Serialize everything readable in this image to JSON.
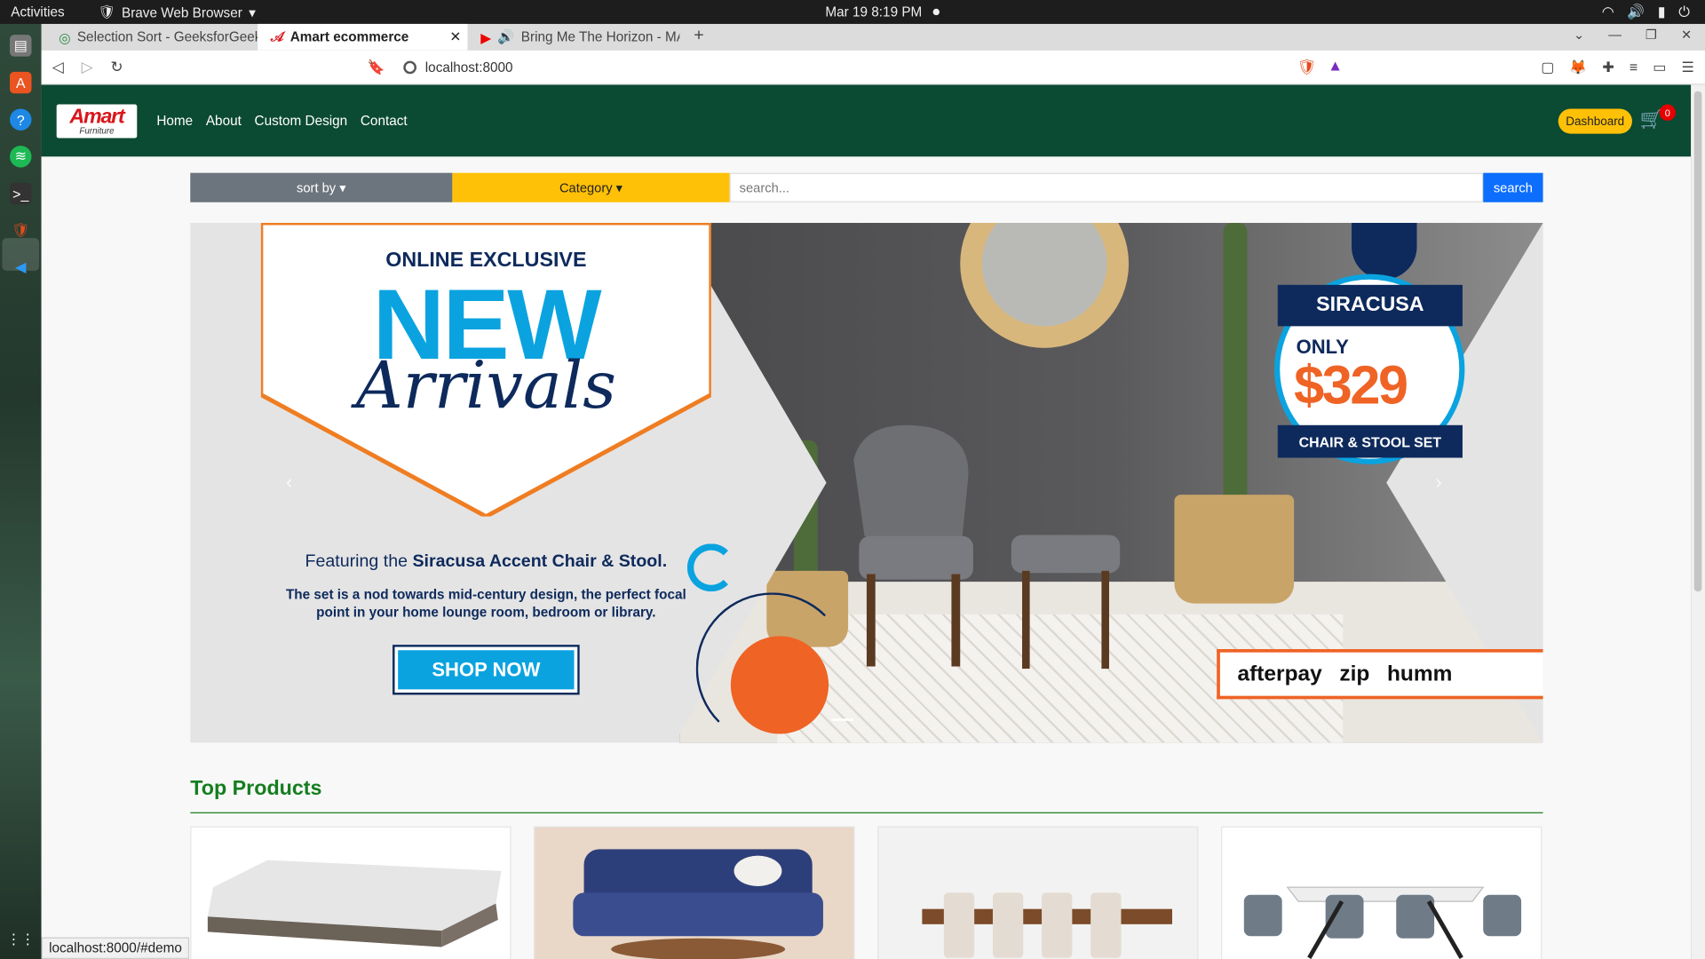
{
  "system": {
    "activities": "Activities",
    "app_name": "Brave Web Browser",
    "clock": "Mar 19  8:19 PM"
  },
  "tabs": [
    {
      "title": "Selection Sort - GeeksforGeek"
    },
    {
      "title": "Amart ecommerce"
    },
    {
      "title": "Bring Me The Horizon - MA"
    }
  ],
  "address": {
    "url": "localhost:8000"
  },
  "site": {
    "logo_main": "Amart",
    "logo_sub": "Furniture",
    "menu": [
      "Home",
      "About",
      "Custom Design",
      "Contact"
    ],
    "dashboard": "Dashboard",
    "cart_count": "0",
    "sort_by": "sort by",
    "category": "Category",
    "search_placeholder": "search...",
    "search_button": "search"
  },
  "banner": {
    "online": "ONLINE EXCLUSIVE",
    "new": "NEW",
    "arrivals": "Arrivals",
    "featuring": "Featuring the",
    "featuring_bold": "Siracusa Accent Chair & Stool.",
    "description": "The set is a nod towards mid-century design, the perfect focal point in your home lounge room, bedroom or library.",
    "shop_now": "SHOP NOW",
    "badge_title": "SIRACUSA",
    "only": "ONLY",
    "price": "$329",
    "set": "CHAIR & STOOL SET",
    "pay": [
      "afterpay",
      "zip",
      "humm"
    ]
  },
  "products": {
    "title": "Top Products"
  },
  "status_url": "localhost:8000/#demo",
  "colors": {
    "navbar": "#0b4a33",
    "accent": "#ffc107",
    "blue": "#0d6efd",
    "title_green": "#157d1f"
  }
}
